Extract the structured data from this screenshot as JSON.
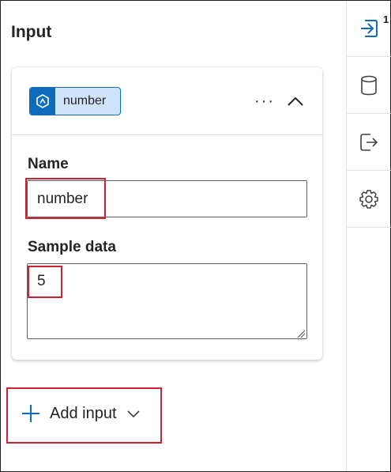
{
  "panel": {
    "title": "Input"
  },
  "input_card": {
    "type_chip_label": "number",
    "more_label": "···",
    "name_label": "Name",
    "name_value": "number",
    "sample_label": "Sample data",
    "sample_value": "5"
  },
  "add_input": {
    "label": "Add input"
  },
  "rail": {
    "items": [
      {
        "icon": "input-arrow-icon",
        "badge": "1",
        "active": true
      },
      {
        "icon": "database-icon"
      },
      {
        "icon": "sign-out-icon"
      },
      {
        "icon": "settings-gear-icon"
      }
    ]
  },
  "colors": {
    "accent": "#0f6cbd",
    "chip_bg": "#cfe4fa",
    "highlight": "#d22030",
    "text": "#242424"
  }
}
